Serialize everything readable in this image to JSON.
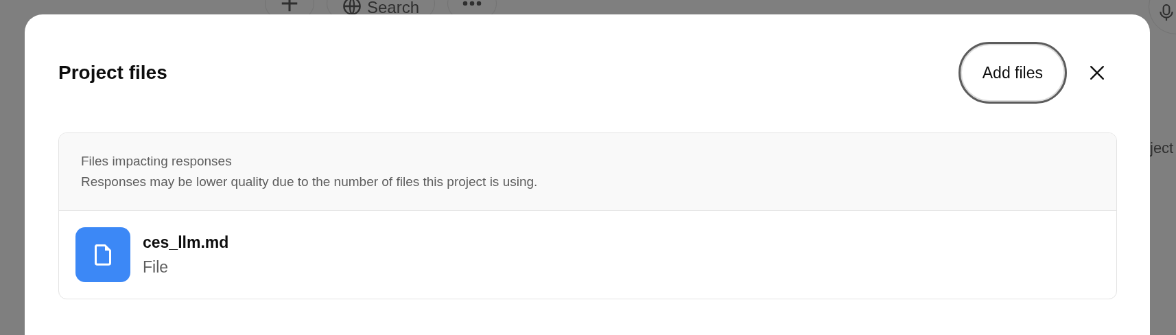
{
  "background": {
    "search_button": "Search",
    "side_text": "ject"
  },
  "dialog": {
    "title": "Project files",
    "add_button": "Add files",
    "notice": {
      "title": "Files impacting responses",
      "message": "Responses may be lower quality due to the number of files this project is using."
    },
    "files": [
      {
        "name": "ces_llm.md",
        "type": "File"
      }
    ]
  }
}
